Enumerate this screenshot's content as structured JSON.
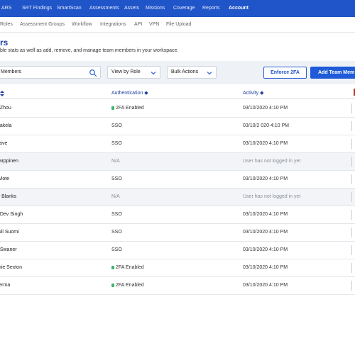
{
  "topnav": {
    "items": [
      "ARS",
      "SRT Findings",
      "SmartScan",
      "Assessments",
      "Assets",
      "Missions",
      "Coverage",
      "Reports",
      "Account"
    ],
    "active_index": 8,
    "background": "#2054c9"
  },
  "subnav": {
    "items": [
      "Roles",
      "Assessment Groups",
      "Workflow",
      "Integrations",
      "API",
      "VPN",
      "File Upload"
    ]
  },
  "page": {
    "title": "rs",
    "description": "ble stats as well as add, remove, and manage team members in your workspace."
  },
  "toolbar": {
    "search_value": "Members",
    "view_by": "View by Role",
    "bulk_actions": "Bulk Actions",
    "enforce_label": "Enforce 2FA",
    "add_label": "Add Team Mem"
  },
  "table": {
    "headers": {
      "name_sort_icon": "sort-icon",
      "authentication": "Authentication ◆",
      "activity": "Activity ◆"
    },
    "rows": [
      {
        "name": "g Zhou",
        "auth": "2FA Enabled",
        "auth_2fa": true,
        "activity": "03/10/2020 4:10 PM",
        "muted": false,
        "shaded": false
      },
      {
        "name": "Makela",
        "auth": "SSO",
        "auth_2fa": false,
        "activity": "03/10/2  020 4:10 PM",
        "muted": false,
        "shaded": false
      },
      {
        "name": "Dave",
        "auth": "SSO",
        "auth_2fa": false,
        "activity": "03/10/2020 4:10 PM",
        "muted": false,
        "shaded": false
      },
      {
        "name": "Karppinen",
        "auth": "N/A",
        "auth_2fa": false,
        "activity": "User has not logged in yet",
        "muted": true,
        "shaded": true
      },
      {
        "name": "l Mote",
        "auth": "SSO",
        "auth_2fa": false,
        "activity": "03/10/2020 4:10 PM",
        "muted": false,
        "shaded": false
      },
      {
        "name": "er Blanks",
        "auth": "N/A",
        "auth_2fa": false,
        "activity": "User has not logged in yet",
        "muted": true,
        "shaded": true
      },
      {
        "name": "h Dev Singh",
        "auth": "SSO",
        "auth_2fa": false,
        "activity": "03/10/2020 4:10 PM",
        "muted": false,
        "shaded": false
      },
      {
        "name": "nuli Suomi",
        "auth": "SSO",
        "auth_2fa": false,
        "activity": "03/10/2020 4:10 PM",
        "muted": false,
        "shaded": false
      },
      {
        "name": "a Swaner",
        "auth": "SSO",
        "auth_2fa": false,
        "activity": "03/10/2020 4:10 PM",
        "muted": false,
        "shaded": false
      },
      {
        "name": "anie Sexton",
        "auth": "2FA Enabled",
        "auth_2fa": true,
        "activity": "03/10/2020 4:10 PM",
        "muted": false,
        "shaded": false
      },
      {
        "name": "Verma",
        "auth": "2FA Enabled",
        "auth_2fa": true,
        "activity": "03/10/2020 4:10 PM",
        "muted": false,
        "shaded": false
      }
    ]
  },
  "colors": {
    "accent": "#2054c9",
    "title": "#1e3f9e",
    "twofa_lock": "#3fb56b",
    "muted_text": "#8a8f96"
  }
}
